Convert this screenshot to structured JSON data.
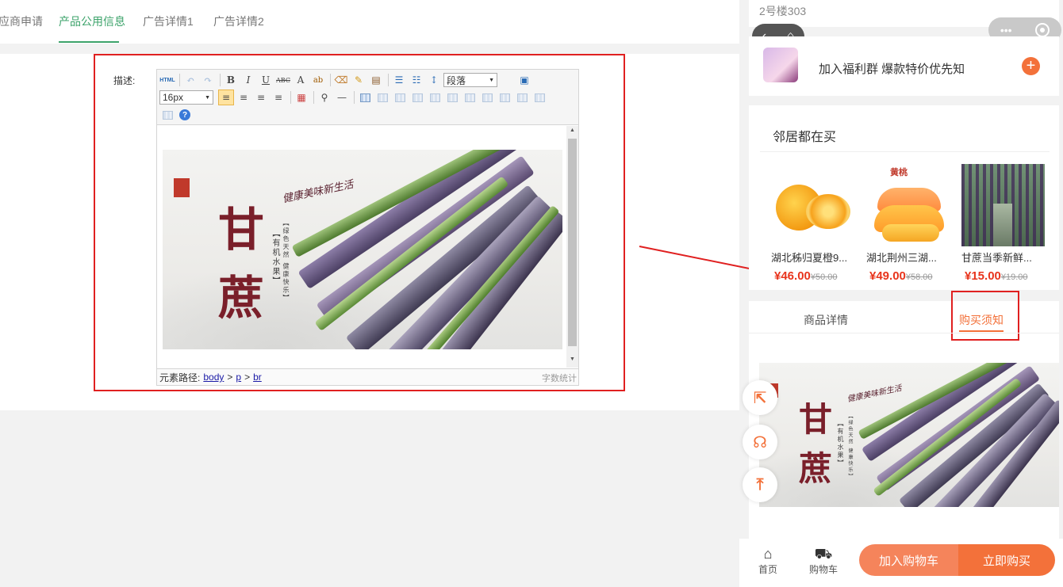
{
  "tabs": [
    {
      "label": "应商申请"
    },
    {
      "label": "产品公用信息"
    },
    {
      "label": "广告详情1"
    },
    {
      "label": "广告详情2"
    }
  ],
  "form": {
    "desc_label": "描述:"
  },
  "editor": {
    "html_label": "HTML",
    "paragraph_select": "段落",
    "font_size_select": "16px",
    "path_label": "元素路径:",
    "path": [
      "body",
      "p",
      "br"
    ],
    "path_sep": ">",
    "word_count": "字数统计",
    "buttons": {
      "bold": "B",
      "italic": "I",
      "underline": "U",
      "strike": "ABC",
      "font_color": "A",
      "bg_color": "ab",
      "hr": "—",
      "help": "?"
    }
  },
  "banner": {
    "title_1": "甘",
    "title_2": "蔗",
    "script": "健康美味新生活",
    "side_left": "【有机水果】",
    "side_right": "【绿色天然 健康快乐】"
  },
  "phone": {
    "address": "2号楼303",
    "group_text": "加入福利群 爆款特价优先知",
    "plus": "+",
    "neighbor_title": "邻居都在买",
    "products": [
      {
        "name": "湖北秭归夏橙9...",
        "price": "¥46.00",
        "orig": "¥50.00"
      },
      {
        "name": "湖北荆州三湖...",
        "price": "¥49.00",
        "orig": "¥58.00"
      },
      {
        "name": "甘蔗当季新鲜...",
        "price": "¥15.00",
        "orig": "¥19.00"
      }
    ],
    "peach_label": "黄桃",
    "detail_tabs": [
      {
        "label": "商品详情"
      },
      {
        "label": "购买须知"
      }
    ],
    "bottom": {
      "home": "首页",
      "cart": "购物车",
      "add_cart": "加入购物车",
      "buy_now": "立即购买"
    }
  },
  "colors": {
    "accent_green": "#3da36b",
    "accent_orange": "#f3713a",
    "highlight_red": "#e02020",
    "price_red": "#e8341c"
  }
}
